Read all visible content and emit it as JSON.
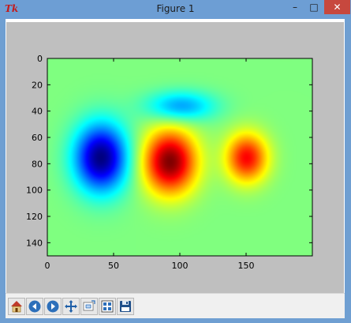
{
  "window": {
    "title": "Figure 1",
    "app_icon": "Tk",
    "controls": {
      "minimize": "–",
      "maximize": "□",
      "close": "✕"
    }
  },
  "toolbar": {
    "buttons": [
      {
        "name": "home-button",
        "icon": "home-icon"
      },
      {
        "name": "back-button",
        "icon": "arrow-left-icon"
      },
      {
        "name": "forward-button",
        "icon": "arrow-right-icon"
      },
      {
        "name": "pan-button",
        "icon": "move-icon"
      },
      {
        "name": "zoom-button",
        "icon": "zoom-rect-icon"
      },
      {
        "name": "configure-subplots-button",
        "icon": "subplots-icon"
      },
      {
        "name": "save-button",
        "icon": "save-icon"
      }
    ]
  },
  "chart_data": {
    "type": "heatmap",
    "colormap": "jet",
    "xlim": [
      0,
      200
    ],
    "ylim": [
      150,
      0
    ],
    "xticks": [
      "0",
      "50",
      "100",
      "150"
    ],
    "yticks": [
      "0",
      "20",
      "40",
      "60",
      "80",
      "100",
      "120",
      "140"
    ],
    "features": [
      {
        "kind": "low",
        "x": 40,
        "y": 75,
        "sx": 14,
        "sy": 18,
        "value": -1.0
      },
      {
        "kind": "low",
        "x": 100,
        "y": 36,
        "sx": 18,
        "sy": 8,
        "value": -0.45
      },
      {
        "kind": "high",
        "x": 92,
        "y": 78,
        "sx": 14,
        "sy": 17,
        "value": 1.0
      },
      {
        "kind": "high",
        "x": 150,
        "y": 75,
        "sx": 11,
        "sy": 13,
        "value": 0.75
      }
    ]
  }
}
